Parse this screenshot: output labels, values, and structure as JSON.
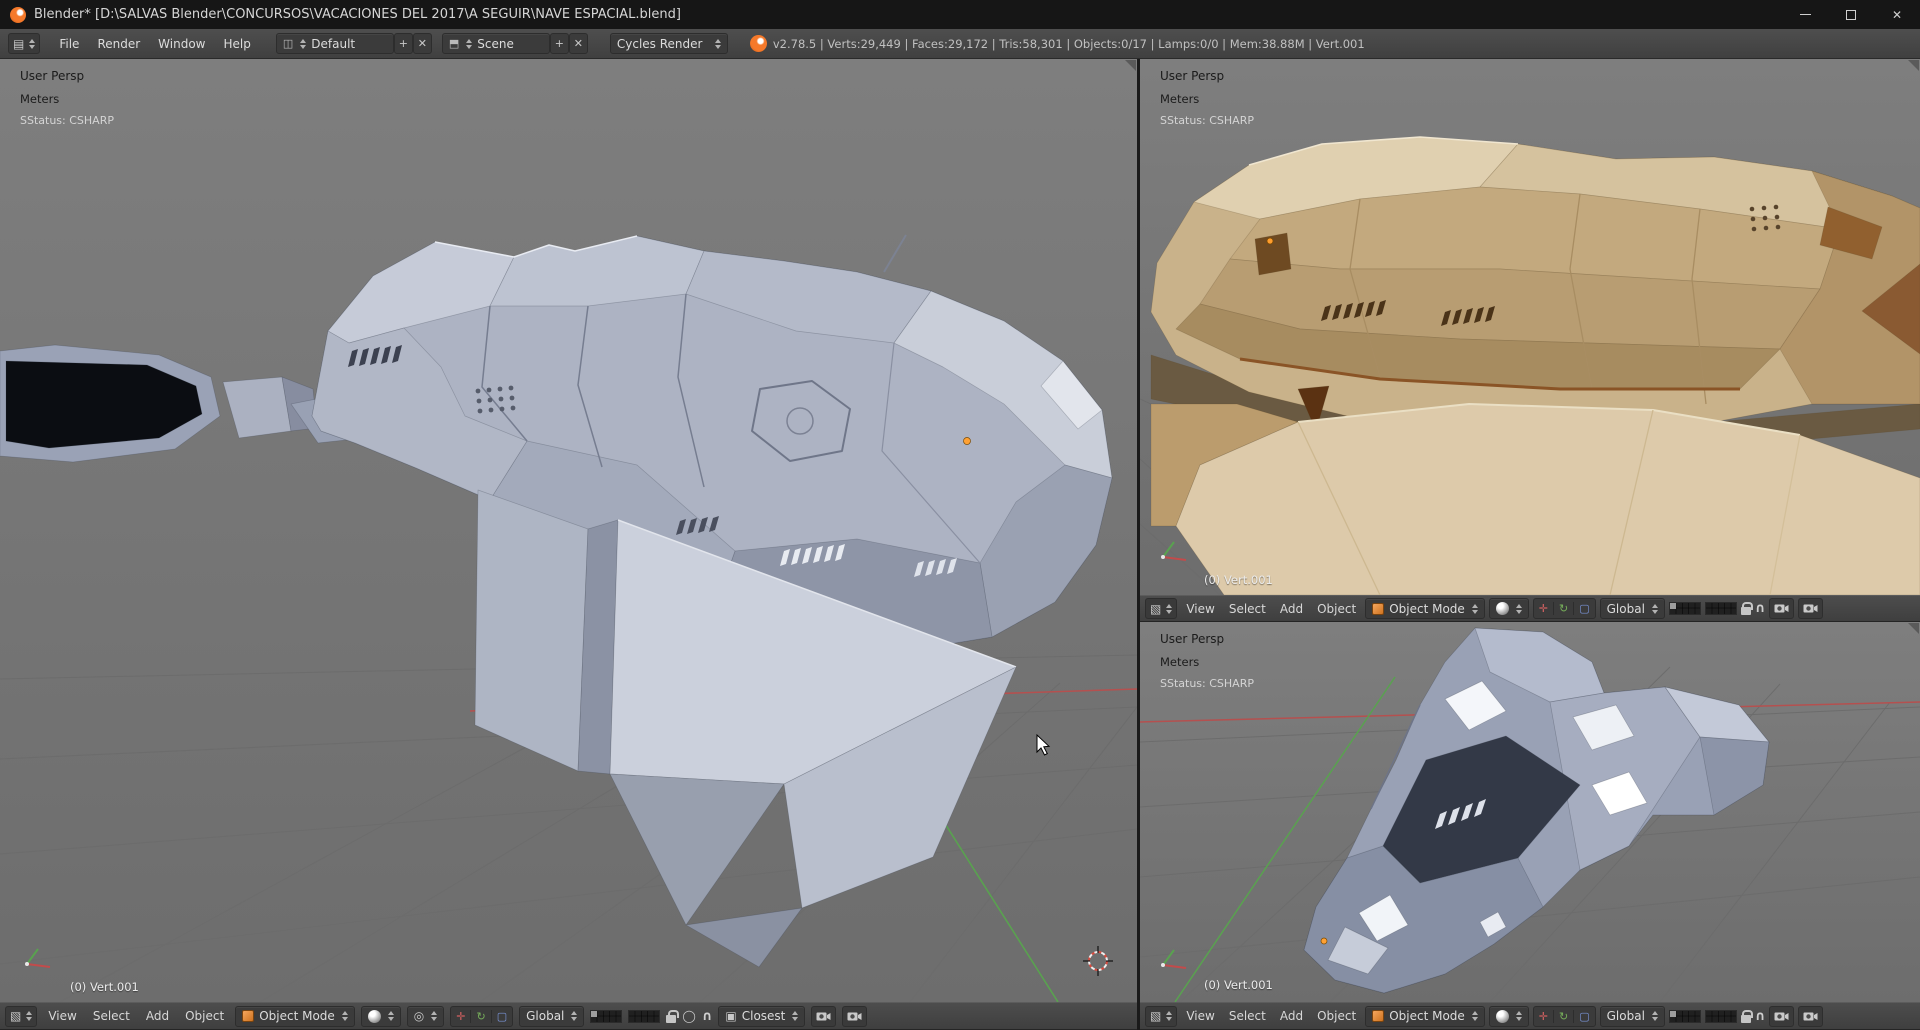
{
  "window": {
    "title": "Blender* [D:\\SALVAS Blender\\CONCURSOS\\VACACIONES DEL 2017\\A SEGUIR\\NAVE ESPACIAL.blend]"
  },
  "icons": {
    "close": "✕",
    "editor_info": "▤",
    "editor_3d": "▧",
    "layout": "◫",
    "scene": "⬒",
    "plus": "+",
    "delete": "✕",
    "pivot": "◎",
    "proportional": "◯",
    "magnet": "∩",
    "manip_translate": "✛",
    "manip_rotate": "↻",
    "manip_scale": "▢",
    "snap_target": "▣"
  },
  "info_bar": {
    "menus": {
      "file": "File",
      "render": "Render",
      "window": "Window",
      "help": "Help"
    },
    "layout_name": "Default",
    "scene_name": "Scene",
    "engine": "Cycles Render",
    "stats": "v2.78.5 | Verts:29,449 | Faces:29,172 | Tris:58,301 | Objects:0/17 | Lamps:0/0 | Mem:38.88M | Vert.001"
  },
  "viewport_header": {
    "view": "View",
    "select": "Select",
    "add": "Add",
    "object": "Object",
    "mode": "Object Mode",
    "orientation": "Global",
    "snap_element": "Closest"
  },
  "viewports": {
    "main": {
      "view_name": "User Persp",
      "unit_system": "Meters",
      "script_status": "SStatus: CSHARP",
      "active_object": "(0) Vert.001"
    },
    "top_right": {
      "view_name": "User Persp",
      "unit_system": "Meters",
      "script_status": "SStatus: CSHARP",
      "active_object": "(0) Vert.001"
    },
    "bottom_right": {
      "view_name": "User Persp",
      "unit_system": "Meters",
      "script_status": "SStatus: CSHARP",
      "active_object": "(0) Vert.001"
    }
  },
  "colors": {
    "accent": "#e8862a",
    "axis_x": "#b5504f",
    "axis_y": "#59a24f",
    "header": "#454545",
    "viewport_bg": "#787878"
  }
}
